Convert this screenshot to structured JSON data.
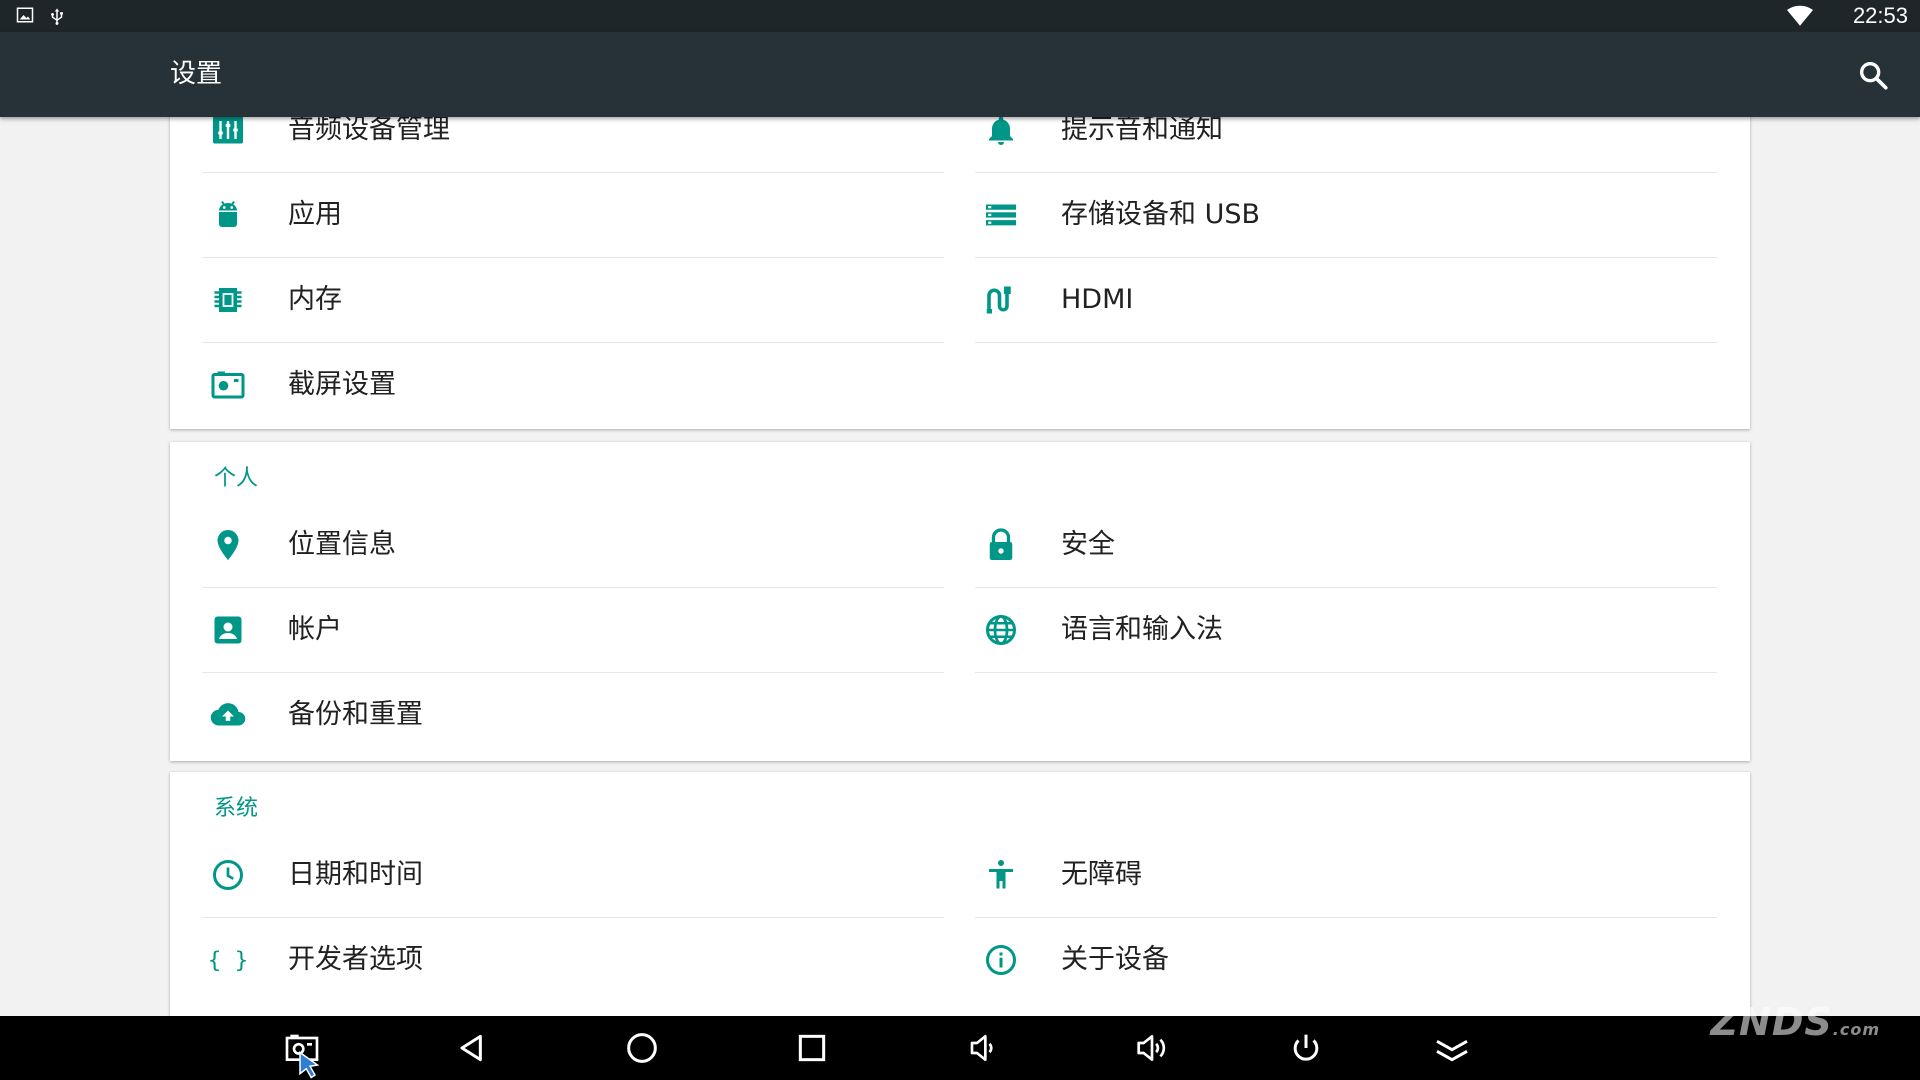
{
  "status_bar": {
    "left_icons": [
      "image-icon",
      "usb-icon"
    ],
    "wifi_icon": "wifi-icon",
    "time": "22:53"
  },
  "action_bar": {
    "title": "设置",
    "search_icon": "search-icon"
  },
  "device_section": {
    "left": [
      {
        "label": "音频设备管理",
        "icon": "equalizer-icon"
      },
      {
        "label": "应用",
        "icon": "android-icon"
      },
      {
        "label": "内存",
        "icon": "memory-chip-icon"
      },
      {
        "label": "截屏设置",
        "icon": "screenshot-icon"
      }
    ],
    "right": [
      {
        "label": "提示音和通知",
        "icon": "bell-icon"
      },
      {
        "label": "存储设备和 USB",
        "icon": "storage-icon"
      },
      {
        "label": "HDMI",
        "icon": "hdmi-cable-icon"
      }
    ]
  },
  "personal_section": {
    "header": "个人",
    "left": [
      {
        "label": "位置信息",
        "icon": "location-pin-icon"
      },
      {
        "label": "帐户",
        "icon": "account-box-icon"
      },
      {
        "label": "备份和重置",
        "icon": "cloud-upload-icon"
      }
    ],
    "right": [
      {
        "label": "安全",
        "icon": "lock-icon"
      },
      {
        "label": "语言和输入法",
        "icon": "globe-icon"
      }
    ]
  },
  "system_section": {
    "header": "系统",
    "left": [
      {
        "label": "日期和时间",
        "icon": "clock-icon"
      },
      {
        "label": "开发者选项",
        "icon": "braces-icon"
      }
    ],
    "right": [
      {
        "label": "无障碍",
        "icon": "accessibility-icon"
      },
      {
        "label": "关于设备",
        "icon": "info-icon"
      }
    ]
  },
  "nav_bar": {
    "buttons": [
      "screenshot-icon",
      "back-icon",
      "home-icon",
      "recents-icon",
      "volume-down-icon",
      "volume-up-icon",
      "power-icon",
      "hide-bar-icon"
    ]
  },
  "watermark": {
    "text": "ZNDS",
    "suffix": ".com"
  },
  "colors": {
    "accent": "#009688",
    "action_bar": "#263238",
    "status_bar": "#1f262a",
    "background": "#f2f2f2"
  }
}
